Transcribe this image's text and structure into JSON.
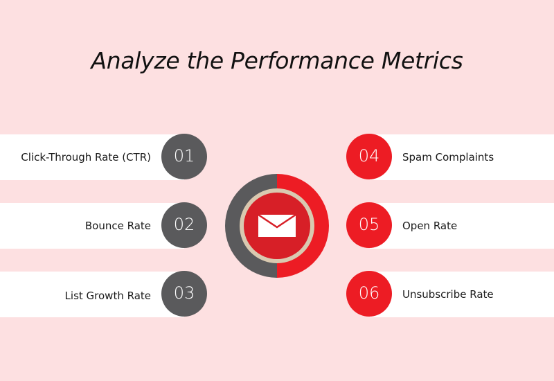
{
  "title": "Analyze the Performance Metrics",
  "colors": {
    "background": "#fde0e1",
    "band": "#ffffff",
    "left_accent": "#5a5a5c",
    "right_accent": "#ed1c24",
    "hub_inner": "#d71f27",
    "hub_ring": "#d9c9b0"
  },
  "center": {
    "icon": "envelope-icon"
  },
  "left_items": [
    {
      "number": "01",
      "label": "Click-Through Rate (CTR)"
    },
    {
      "number": "02",
      "label": "Bounce Rate"
    },
    {
      "number": "03",
      "label": "List Growth Rate"
    }
  ],
  "right_items": [
    {
      "number": "04",
      "label": "Spam Complaints"
    },
    {
      "number": "05",
      "label": "Open Rate"
    },
    {
      "number": "06",
      "label": "Unsubscribe Rate"
    }
  ]
}
